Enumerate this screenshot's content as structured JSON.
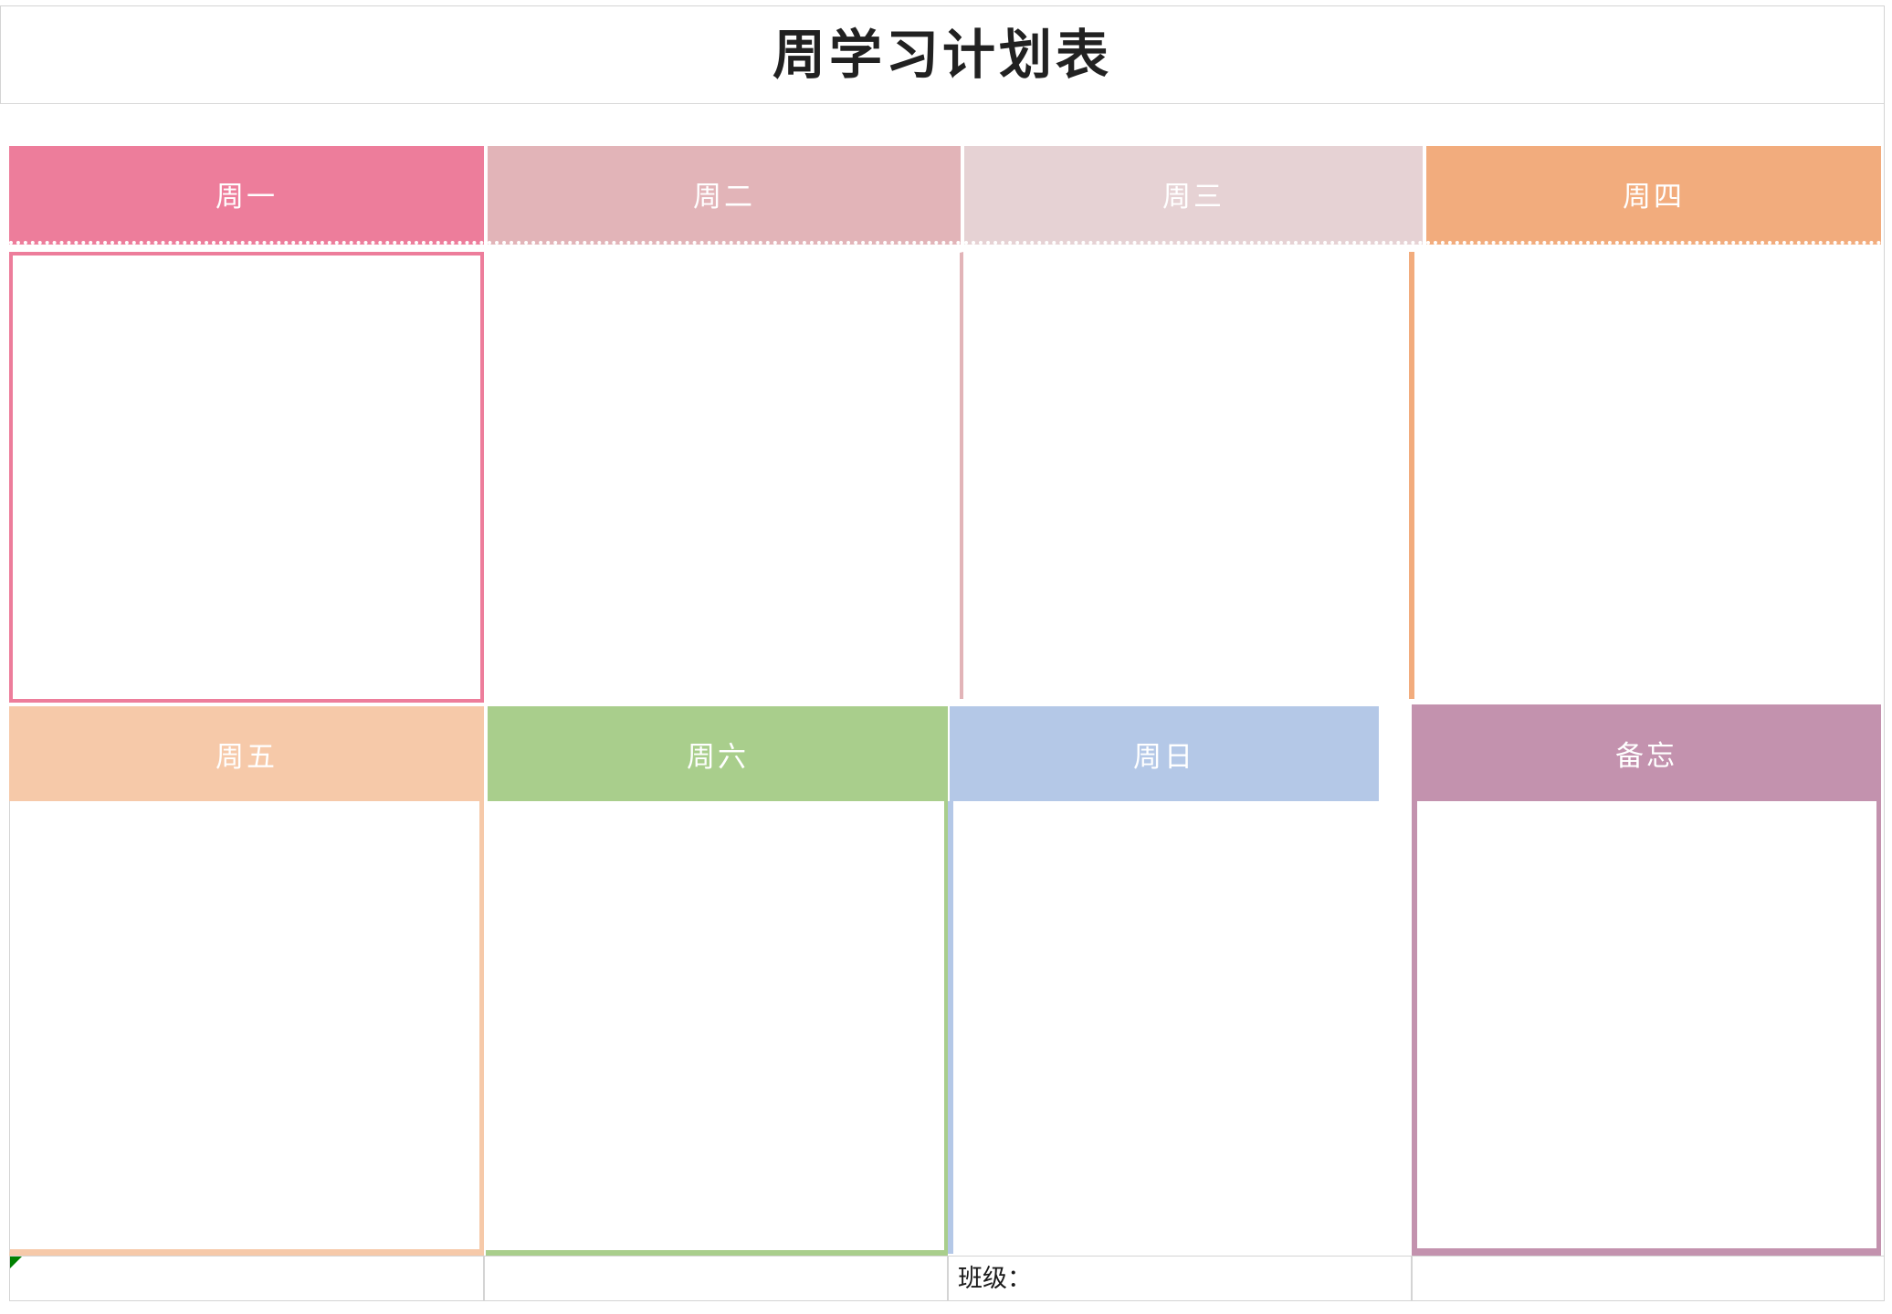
{
  "document": {
    "title": "周学习计划表"
  },
  "palette": {
    "monday": "#ED7D9B",
    "tuesday": "#E2B4B8",
    "wednesday": "#E6D2D4",
    "thursday": "#F2AC7D",
    "friday": "#F6C9A9",
    "saturday": "#A9CE8C",
    "sunday": "#B4C8E7",
    "memo": "#C392AE",
    "grid_line": "#D4D4D4",
    "title_text": "#212121",
    "header_text": "#FFFFFF",
    "comment_marker": "#008000"
  },
  "grid": {
    "row1_headers": [
      {
        "id": "monday",
        "label": "周一",
        "color": "#ED7D9B"
      },
      {
        "id": "tuesday",
        "label": "周二",
        "color": "#E2B4B8"
      },
      {
        "id": "wednesday",
        "label": "周三",
        "color": "#E6D2D4"
      },
      {
        "id": "thursday",
        "label": "周四",
        "color": "#F2AC7D"
      }
    ],
    "row2_headers": [
      {
        "id": "friday",
        "label": "周五",
        "color": "#F6C9A9"
      },
      {
        "id": "saturday",
        "label": "周六",
        "color": "#A9CE8C"
      },
      {
        "id": "sunday",
        "label": "周日",
        "color": "#B4C8E7"
      },
      {
        "id": "memo",
        "label": "备忘",
        "color": "#C392AE"
      }
    ],
    "row1_cells": [
      {
        "id": "monday",
        "value": ""
      },
      {
        "id": "tuesday",
        "value": ""
      },
      {
        "id": "wednesday",
        "value": ""
      },
      {
        "id": "thursday",
        "value": ""
      }
    ],
    "row2_cells": [
      {
        "id": "friday",
        "value": ""
      },
      {
        "id": "saturday",
        "value": ""
      },
      {
        "id": "sunday",
        "value": ""
      },
      {
        "id": "memo",
        "value": ""
      }
    ]
  },
  "footer": {
    "cells": [
      {
        "id": "foot-1",
        "label": ""
      },
      {
        "id": "foot-2",
        "label": ""
      },
      {
        "id": "foot-class",
        "label": "班级："
      },
      {
        "id": "foot-4",
        "label": ""
      }
    ]
  }
}
